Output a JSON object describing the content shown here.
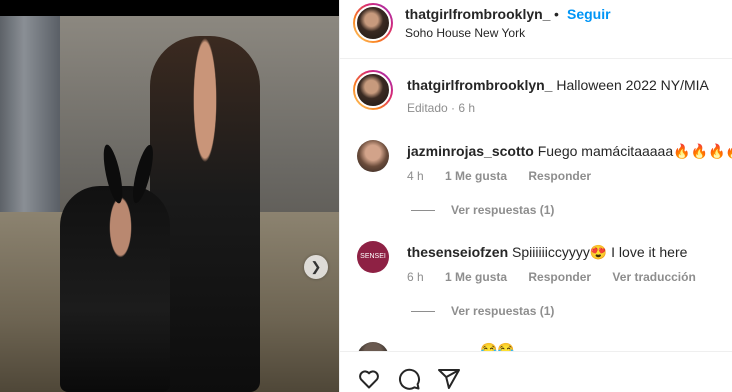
{
  "post": {
    "author": "thatgirlfrombrooklyn_",
    "follow_label": "Seguir",
    "separator": "•",
    "location": "Soho House New York"
  },
  "caption": {
    "username": "thatgirlfrombrooklyn_",
    "text": "Halloween 2022 NY/MIA",
    "edited": "Editado · 6 h"
  },
  "comments": [
    {
      "username": "jazminrojas_scotto",
      "text": "Fuego mamácitaaaaa🔥🔥🔥🔥",
      "time": "4 h",
      "likes": "1 Me gusta",
      "reply": "Responder",
      "translate": "",
      "view_replies": "Ver respuestas (1)"
    },
    {
      "username": "thesenseiofzen",
      "text": "Spiiiiiiccyyyy😍 I love it here",
      "time": "6 h",
      "likes": "1 Me gusta",
      "reply": "Responder",
      "translate": "Ver traducción",
      "view_replies": "Ver respuestas (1)",
      "avatar_text": "SENSEI"
    }
  ],
  "partial_comment": {
    "text": "😂😂"
  },
  "icons": {
    "like": "heart-icon",
    "comment": "comment-icon",
    "share": "share-icon",
    "next": "chevron-right-icon"
  },
  "colors": {
    "accent": "#0095f6",
    "muted": "#8e8e8e",
    "text": "#262626"
  }
}
